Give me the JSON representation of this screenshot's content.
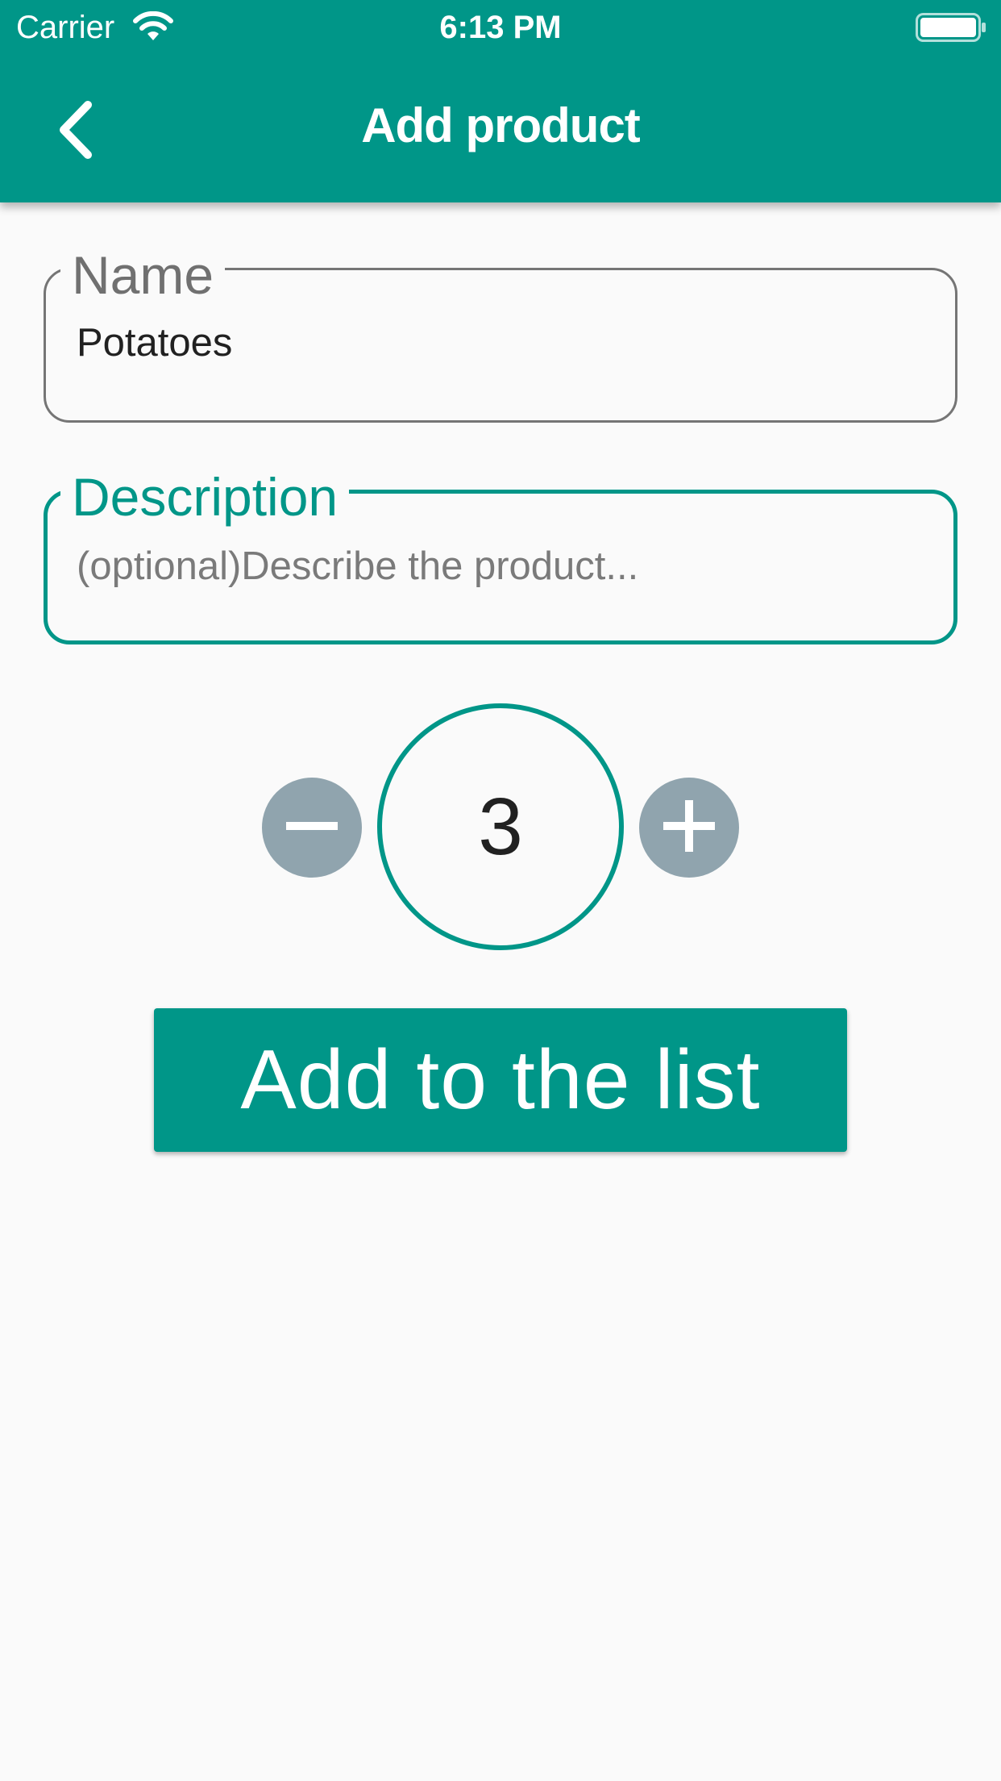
{
  "status_bar": {
    "carrier": "Carrier",
    "time": "6:13 PM",
    "wifi_icon": "wifi-icon",
    "battery_icon": "battery-full-icon"
  },
  "app_bar": {
    "title": "Add product",
    "back_icon": "chevron-left-icon"
  },
  "form": {
    "name": {
      "label": "Name",
      "value": "Potatoes"
    },
    "description": {
      "label": "Description",
      "value": "",
      "placeholder": "(optional)Describe the product...",
      "focused": true
    }
  },
  "quantity": {
    "value": "3",
    "decrement_icon": "minus-icon",
    "increment_icon": "plus-icon"
  },
  "actions": {
    "add_label": "Add to the list"
  },
  "colors": {
    "primary": "#009688",
    "stepper_button": "#90A4AE",
    "background": "#FAFAFA",
    "text": "#212121",
    "muted": "#757575"
  }
}
